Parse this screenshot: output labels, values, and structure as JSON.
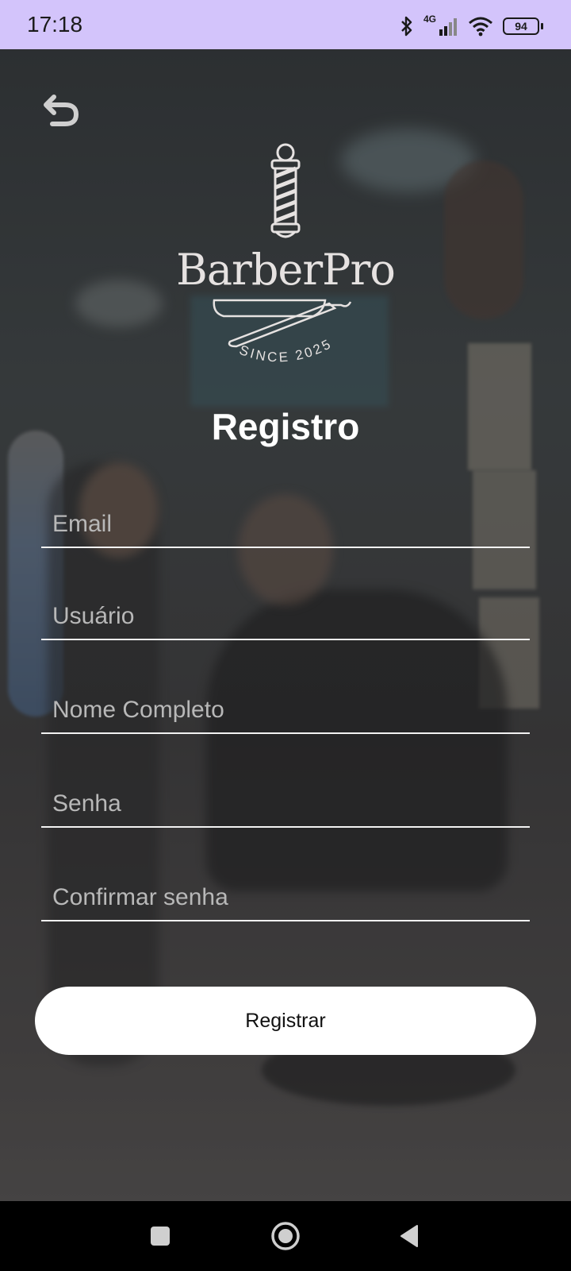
{
  "status_bar": {
    "time": "17:18",
    "network": "4G",
    "battery": "94",
    "icons": [
      "bluetooth-icon",
      "signal-icon",
      "wifi-icon",
      "battery-icon"
    ]
  },
  "header": {
    "back_icon": "back-arrow-icon"
  },
  "logo": {
    "brand_name": "BarberPro",
    "tagline": "SINCE 2025"
  },
  "page": {
    "title": "Registro"
  },
  "form": {
    "fields": [
      {
        "placeholder": "Email",
        "value": ""
      },
      {
        "placeholder": "Usuário",
        "value": ""
      },
      {
        "placeholder": "Nome Completo",
        "value": ""
      },
      {
        "placeholder": "Senha",
        "value": ""
      },
      {
        "placeholder": "Confirmar senha",
        "value": ""
      }
    ],
    "submit_label": "Registrar"
  },
  "navigation": {
    "buttons": [
      "recents-icon",
      "home-icon",
      "back-icon"
    ]
  },
  "colors": {
    "status_bar": "#d3c4fb",
    "button_bg": "#ffffff",
    "nav_bar": "#000000"
  }
}
